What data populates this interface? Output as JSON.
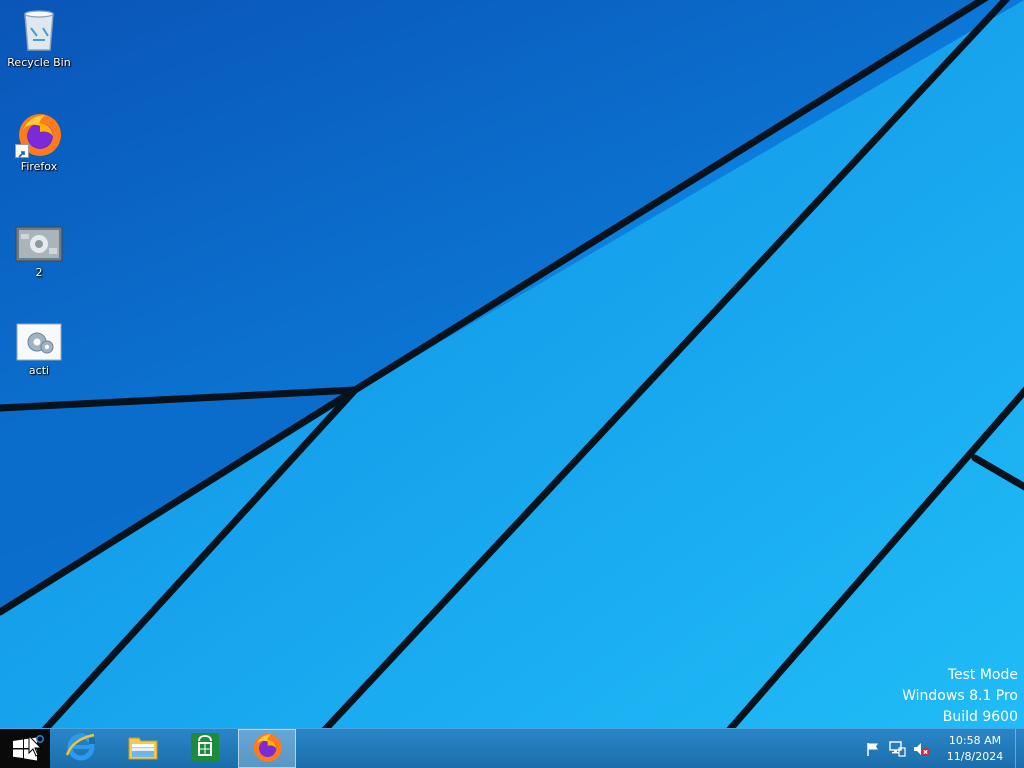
{
  "desktop": {
    "icons": [
      {
        "label": "Recycle Bin",
        "icon": "recycle-bin-icon"
      },
      {
        "label": "Firefox",
        "icon": "firefox-icon"
      },
      {
        "label": "2",
        "icon": "image-file-icon"
      },
      {
        "label": "acti",
        "icon": "settings-file-icon"
      }
    ]
  },
  "watermark": {
    "line1": "Test Mode",
    "line2": "Windows 8.1 Pro",
    "line3": "Build 9600"
  },
  "taskbar": {
    "start_icon": "windows-logo-icon",
    "pinned": [
      {
        "icon": "internet-explorer-icon"
      },
      {
        "icon": "file-explorer-icon"
      },
      {
        "icon": "store-icon"
      },
      {
        "icon": "firefox-icon",
        "active": true
      }
    ],
    "tray": {
      "icons": [
        "action-center-flag-icon",
        "network-icon",
        "volume-muted-icon"
      ],
      "time": "10:58 AM",
      "date": "11/8/2024"
    }
  },
  "colors": {
    "accent": "#1c6eab",
    "desktop_light": "#1bb6f5",
    "desktop_dark": "#0a5fc4"
  }
}
